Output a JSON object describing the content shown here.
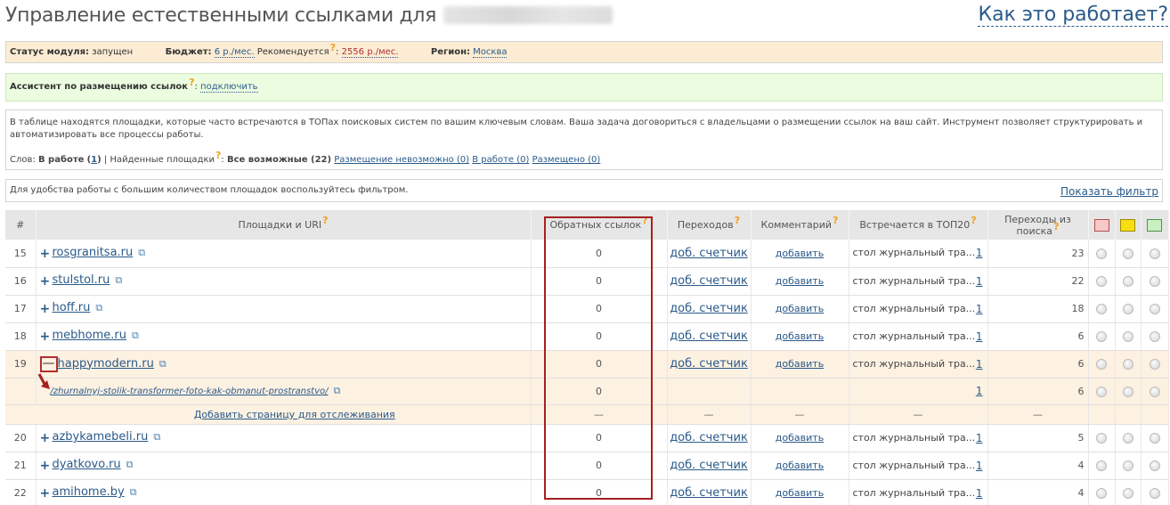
{
  "header": {
    "title": "Управление естественными ссылками для",
    "domain": "bestmebelshop.ru",
    "how_link": "Как это работает?"
  },
  "status": {
    "module_label": "Статус модуля:",
    "module_value": "запущен",
    "budget_label": "Бюджет:",
    "budget_value": "6 р./мес.",
    "recommended_label": "Рекомендуется",
    "recommended_value": "2556 р./мес.",
    "region_label": "Регион:",
    "region_value": "Москва"
  },
  "assistant": {
    "label": "Ассистент по размещению ссылок",
    "action": "подключить"
  },
  "info": {
    "description": "В таблице находятся площадки, которые часто встречаются в ТОПах поисковых систем по вашим ключевым словам. Ваша задача договориться с владельцами о размещении ссылок на ваш сайт. Инструмент позволяет структурировать и автоматизировать все процессы работы.",
    "words_label": "Слов:",
    "in_work_label": "В работе",
    "in_work_count": "1",
    "found_label": "Найденные площадки",
    "all_label": "Все возможные (22)",
    "impossible": "Размещение невозможно (0)",
    "in_work_tab": "В работе (0)",
    "placed": "Размещено (0)"
  },
  "filter": {
    "hint": "Для удобства работы с большим количеством площадок воспользуйтесь фильтром.",
    "show": "Показать фильтр"
  },
  "table": {
    "columns": {
      "num": "#",
      "site": "Площадки и URI",
      "backlinks": "Обратных ссылок",
      "transitions": "Переходов",
      "comment": "Комментарий",
      "top20": "Встречается в ТОП20",
      "search": "Переходы из поиска"
    },
    "colors": {
      "red": "#f9c8c8",
      "yellow": "#f7de10",
      "green": "#c8f0c0"
    },
    "add_counter": "доб. счетчик",
    "add_comment": "добавить",
    "top20_text": "стол журнальный тра...",
    "dash": "—",
    "add_page": "Добавить страницу для отслеживания",
    "rows": [
      {
        "num": "15",
        "site": "rosgranitsa.ru",
        "backlinks": "0",
        "top20": "1",
        "search": "23"
      },
      {
        "num": "16",
        "site": "stulstol.ru",
        "backlinks": "0",
        "top20": "1",
        "search": "22"
      },
      {
        "num": "17",
        "site": "hoff.ru",
        "backlinks": "0",
        "top20": "1",
        "search": "18"
      },
      {
        "num": "18",
        "site": "mebhome.ru",
        "backlinks": "0",
        "top20": "1",
        "search": "6"
      },
      {
        "num": "19",
        "site": "happymodern.ru",
        "backlinks": "0",
        "top20": "1",
        "search": "6"
      },
      {
        "num": "20",
        "site": "azbykamebeli.ru",
        "backlinks": "0",
        "top20": "1",
        "search": "5"
      },
      {
        "num": "21",
        "site": "dyatkovo.ru",
        "backlinks": "0",
        "top20": "1",
        "search": "4"
      },
      {
        "num": "22",
        "site": "amihome.by",
        "backlinks": "0",
        "top20": "1",
        "search": "4"
      }
    ],
    "subrow": {
      "path": "/zhurnalnyj-stolik-transformer-foto-kak-obmanut-prostranstvo/",
      "backlinks": "0",
      "top20": "1",
      "search": "6"
    }
  }
}
